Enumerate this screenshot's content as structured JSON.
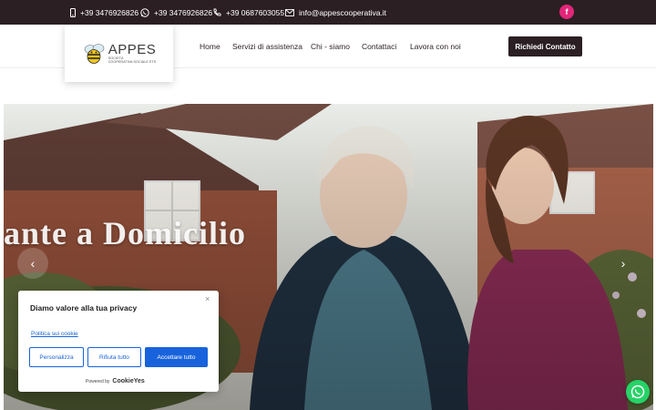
{
  "topbar": {
    "phone1": "+39 3476926826",
    "whatsapp": "+39 3476926826",
    "phone2": "+39 0687603055",
    "email": "info@appescooperativa.it",
    "facebook": "f"
  },
  "logo": {
    "name": "APPES",
    "line1": "SOCIETÀ",
    "line2": "COOPERATIVA SOCIALE ETS"
  },
  "nav": {
    "items": [
      "Home",
      "Servizi di assistenza",
      "Chi - siamo",
      "Contattaci",
      "Lavora con noi"
    ],
    "cta": "Richiedi Contatto"
  },
  "hero": {
    "title": "ante a Domicilio",
    "prev": "‹",
    "next": "›"
  },
  "cookie": {
    "title": "Diamo valore alla tua privacy",
    "close": "×",
    "link": "Politica sui cookie",
    "btn_customize": "Personalizza",
    "btn_reject": "Rifiuta tutto",
    "btn_accept": "Accettare tutto",
    "powered_by": "Powered by",
    "brand": "CookieYes"
  },
  "colors": {
    "dark": "#2b1f23",
    "accent_pink": "#e2267a",
    "cookie_blue": "#1863dc",
    "whatsapp_green": "#25d366"
  }
}
